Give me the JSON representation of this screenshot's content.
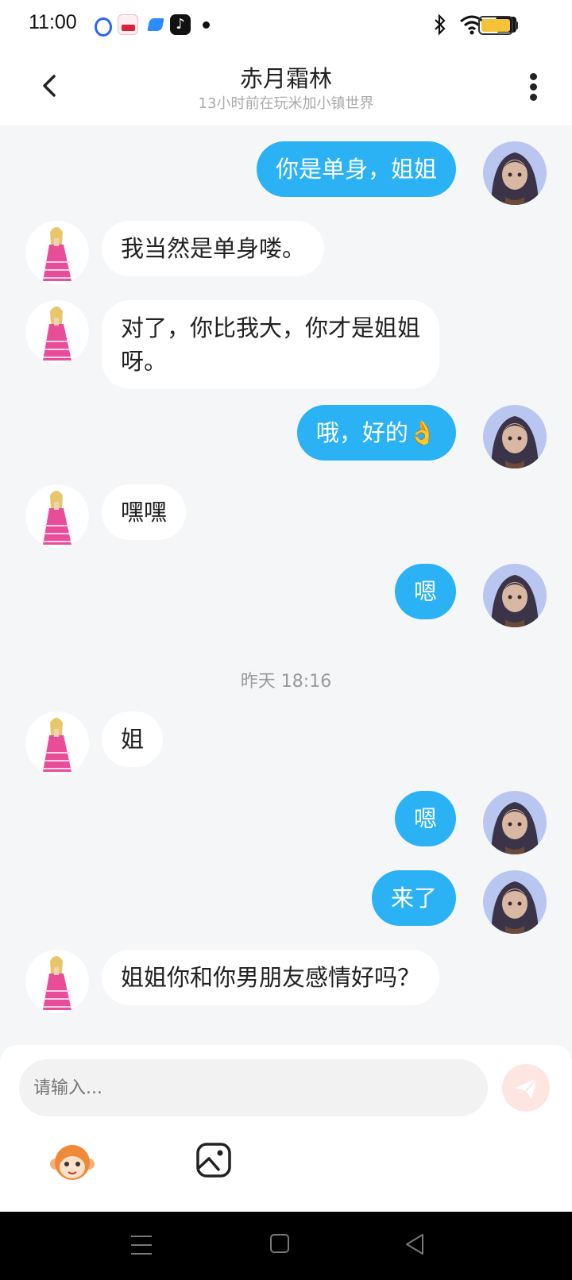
{
  "status_bar": {
    "time": "11:00",
    "notification_icons": [
      "baidu-icon",
      "news-app-icon",
      "blue-app-icon",
      "tiktok-icon",
      "dot-icon"
    ],
    "right_icons": [
      "bluetooth-icon",
      "wifi-icon",
      "no-sim-icon",
      "battery-icon"
    ],
    "battery_color": "#f6c338"
  },
  "header": {
    "title": "赤月霜林",
    "subtitle": "13小时前在玩米加小镇世界"
  },
  "messages": [
    {
      "side": "out",
      "text": "你是单身，姐姐"
    },
    {
      "side": "in",
      "text": "我当然是单身喽。"
    },
    {
      "side": "in",
      "text": "对了，你比我大，你才是姐姐\n呀。"
    },
    {
      "side": "out",
      "text": "哦，好的👌"
    },
    {
      "side": "in",
      "text": "嘿嘿"
    },
    {
      "side": "out",
      "text": "嗯"
    },
    {
      "side": "in",
      "text": "姐"
    },
    {
      "side": "out",
      "text": "嗯"
    },
    {
      "side": "out",
      "text": "来了"
    },
    {
      "side": "in",
      "text": "姐姐你和你男朋友感情好吗？"
    }
  ],
  "timestamp": "昨天 18:16",
  "input": {
    "placeholder": "请输入..."
  },
  "colors": {
    "outgoing_bubble": "#2ab2f5",
    "incoming_bubble": "#ffffff",
    "background": "#f5f6f8",
    "send_button": "#fde5e2"
  }
}
